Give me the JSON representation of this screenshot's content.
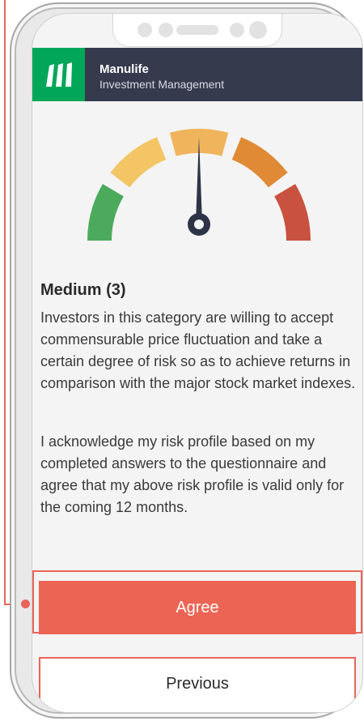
{
  "header": {
    "brand_name": "Manulife",
    "brand_sub": "Investment Management"
  },
  "gauge": {
    "segments": 5,
    "current_level": 3,
    "colors": [
      "#4caa5d",
      "#f3c565",
      "#f0b55c",
      "#e08a36",
      "#c9513f"
    ],
    "needle_color": "#2e3448"
  },
  "risk": {
    "title": "Medium (3)",
    "description": "Investors in this category are willing to accept commensurable price fluctuation and take a certain degree of risk so as to achieve returns in comparison with the major stock market indexes.",
    "acknowledgement": "I acknowledge my risk profile based on my completed answers to the questionnaire and agree that my above risk profile is valid only for the coming 12 months."
  },
  "actions": {
    "agree_label": "Agree",
    "previous_label": "Previous"
  },
  "colors": {
    "accent": "#ec6453",
    "brand_green": "#00a758",
    "header_bg": "#353a4d"
  }
}
